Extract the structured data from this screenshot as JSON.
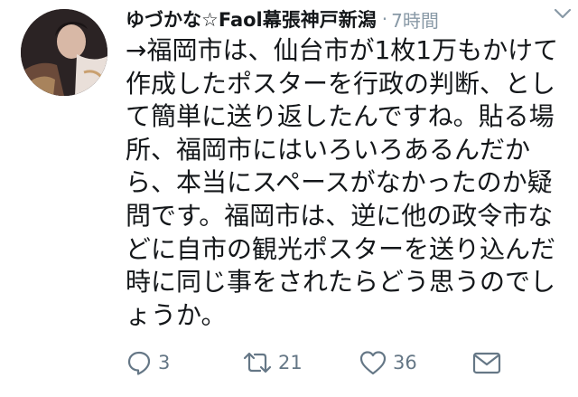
{
  "tweet": {
    "display_name": "ゆづかな☆Faol幕張神戸新潟",
    "separator": "·",
    "timestamp": "7時間",
    "text_lines": [
      "→福岡市は、仙台市が1枚1万もかけて",
      "作成したポスターを行政の判断、とし",
      "て簡単に送り返したんですね。貼る場",
      "所、福岡市にはいろいろあるんだか",
      "ら、本当にスペースがなかったのか疑",
      "問です。福岡市は、逆に他の政令市な",
      "どに自市の観光ポスターを送り込んだ",
      "時に同じ事をされたらどう思うのでし",
      "ょうか。"
    ]
  },
  "actions": {
    "reply_count": "3",
    "retweet_count": "21",
    "like_count": "36"
  },
  "icons": {
    "caret": "chevron-down-icon",
    "reply": "reply-icon",
    "retweet": "retweet-icon",
    "like": "heart-icon",
    "dm": "envelope-icon"
  },
  "colors": {
    "text": "#14171a",
    "secondary": "#8899a6",
    "action": "#657786"
  }
}
